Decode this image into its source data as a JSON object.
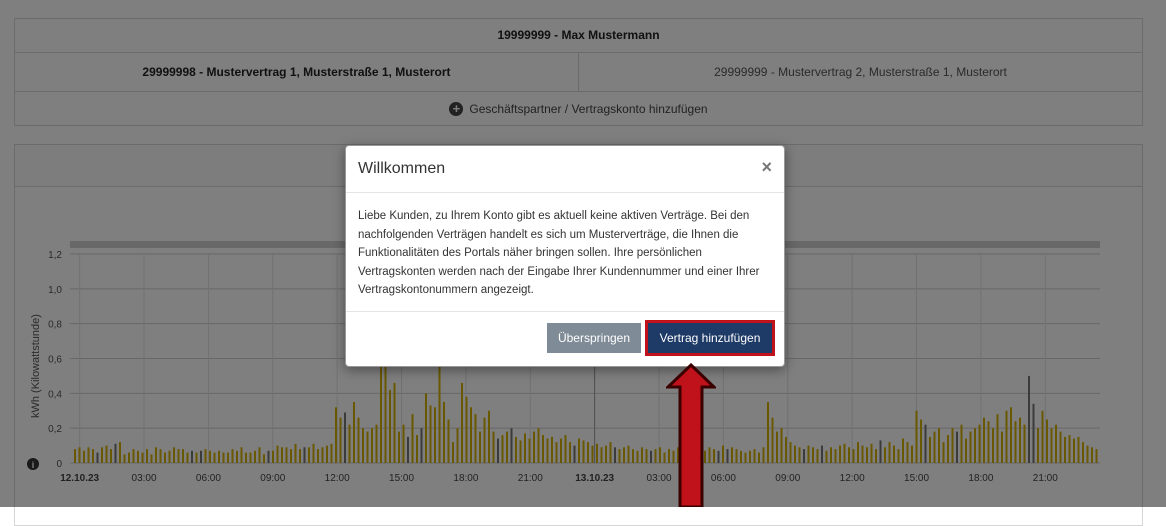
{
  "customer": {
    "title": "19999999 - Max Mustermann"
  },
  "contracts": [
    {
      "label": "29999998 - Mustervertrag 1, Musterstraße 1, Musterort",
      "active": true
    },
    {
      "label": "29999999 - Mustervertrag 2, Musterstraße 1, Musterort",
      "active": false
    }
  ],
  "add_partner": {
    "label": "Geschäftspartner / Vertragskonto hinzufügen",
    "icon": "plus-circle-icon"
  },
  "chart_data": {
    "type": "bar",
    "ylabel": "kWh (Kilowattstunde)",
    "ylim": [
      0,
      1.2
    ],
    "yticks": [
      "0",
      "0,2",
      "0,4",
      "0,6",
      "0,8",
      "1,0",
      "1,2"
    ],
    "xticks": [
      "12.10.23",
      "03:00",
      "06:00",
      "09:00",
      "12:00",
      "15:00",
      "18:00",
      "21:00",
      "13.10.23",
      "03:00",
      "06:00",
      "09:00",
      "12:00",
      "15:00",
      "18:00",
      "21:00"
    ],
    "bar_color": "#d4b000",
    "alt_bar_color": "#777777",
    "values": [
      0.08,
      0.09,
      0.07,
      0.09,
      0.08,
      0.06,
      0.09,
      0.1,
      0.08,
      0.11,
      0.12,
      0.05,
      0.06,
      0.08,
      0.07,
      0.06,
      0.08,
      0.05,
      0.09,
      0.08,
      0.06,
      0.07,
      0.09,
      0.08,
      0.08,
      0.06,
      0.07,
      0.06,
      0.07,
      0.08,
      0.07,
      0.06,
      0.07,
      0.06,
      0.06,
      0.08,
      0.07,
      0.09,
      0.06,
      0.06,
      0.07,
      0.09,
      0.05,
      0.07,
      0.07,
      0.1,
      0.09,
      0.09,
      0.08,
      0.11,
      0.08,
      0.09,
      0.09,
      0.11,
      0.08,
      0.09,
      0.1,
      0.11,
      0.32,
      0.26,
      0.29,
      0.22,
      0.35,
      0.26,
      0.2,
      0.18,
      0.2,
      0.22,
      0.85,
      0.62,
      0.42,
      0.46,
      0.18,
      0.22,
      0.15,
      0.28,
      0.16,
      0.2,
      0.4,
      0.33,
      0.32,
      0.72,
      0.35,
      0.25,
      0.12,
      0.2,
      0.46,
      0.38,
      0.32,
      0.28,
      0.18,
      0.26,
      0.3,
      0.18,
      0.14,
      0.16,
      0.18,
      0.2,
      0.15,
      0.13,
      0.17,
      0.14,
      0.18,
      0.2,
      0.16,
      0.14,
      0.15,
      0.12,
      0.14,
      0.16,
      0.12,
      0.1,
      0.14,
      0.13,
      0.12,
      0.1,
      0.11,
      0.09,
      0.1,
      0.12,
      0.09,
      0.08,
      0.09,
      0.1,
      0.08,
      0.07,
      0.09,
      0.08,
      0.07,
      0.08,
      0.09,
      0.06,
      0.08,
      0.07,
      0.09,
      0.08,
      0.1,
      0.09,
      0.11,
      0.08,
      0.07,
      0.09,
      0.08,
      0.07,
      0.1,
      0.08,
      0.09,
      0.08,
      0.07,
      0.06,
      0.07,
      0.08,
      0.06,
      0.09,
      0.35,
      0.26,
      0.18,
      0.2,
      0.15,
      0.12,
      0.1,
      0.09,
      0.08,
      0.1,
      0.09,
      0.08,
      0.1,
      0.07,
      0.09,
      0.08,
      0.1,
      0.11,
      0.09,
      0.08,
      0.12,
      0.1,
      0.09,
      0.11,
      0.08,
      0.13,
      0.09,
      0.12,
      0.1,
      0.08,
      0.14,
      0.12,
      0.1,
      0.3,
      0.25,
      0.22,
      0.15,
      0.18,
      0.2,
      0.12,
      0.16,
      0.2,
      0.18,
      0.22,
      0.14,
      0.18,
      0.2,
      0.22,
      0.26,
      0.24,
      0.2,
      0.28,
      0.18,
      0.3,
      0.32,
      0.24,
      0.26,
      0.22,
      0.5,
      0.34,
      0.2,
      0.3,
      0.25,
      0.2,
      0.22,
      0.18,
      0.15,
      0.16,
      0.14,
      0.15,
      0.12,
      0.1,
      0.09,
      0.08
    ]
  },
  "modal": {
    "title": "Willkommen",
    "close_label": "×",
    "body": "Liebe Kunden, zu Ihrem Konto gibt es aktuell keine aktiven Verträge. Bei den nachfolgenden Verträgen handelt es sich um Musterverträge, die Ihnen die Funktionalitäten des Portals näher bringen sollen. Ihre persönlichen Vertragskonten werden nach der Eingabe Ihrer Kundennummer und einer Ihrer Vertragskontonummern angezeigt.",
    "skip_label": "Überspringen",
    "add_label": "Vertrag hinzufügen"
  },
  "colors": {
    "overlay": "rgba(0,0,0,0.5)",
    "primary_button": "#1e3a66",
    "secondary_button": "#7f8c97",
    "highlight": "#c0121b"
  }
}
